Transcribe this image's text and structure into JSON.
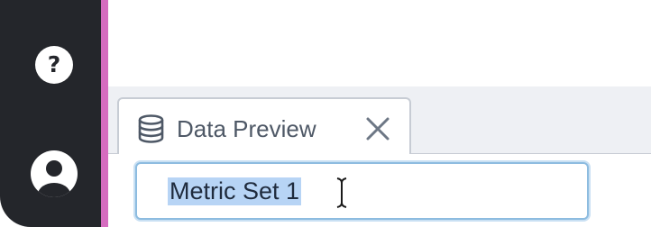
{
  "sidebar": {
    "help_icon": "question-icon",
    "help_glyph": "?",
    "user_icon": "user-account-icon",
    "accent_color": "#d56cbf",
    "background_color": "#24262b"
  },
  "tab": {
    "icon": "database-icon",
    "label": "Data Preview",
    "close_icon": "close-icon"
  },
  "editor": {
    "name_value": "Metric Set 1",
    "text_selected": true,
    "selection_color": "#b7d4f5",
    "focus_color": "#8dbce0",
    "cursor_icon": "text-cursor-icon"
  }
}
